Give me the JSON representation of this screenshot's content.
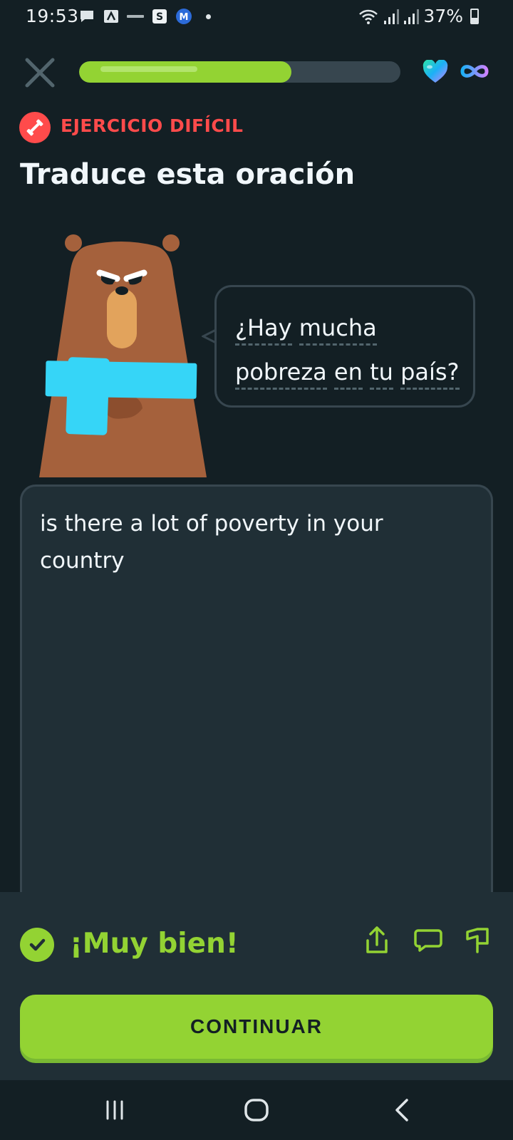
{
  "status_bar": {
    "time": "19:53",
    "battery": "37%",
    "notification_icons": [
      "message-icon",
      "app-a-icon",
      "app-small-icon",
      "s-app-icon",
      "m-app-icon",
      "dot-icon"
    ]
  },
  "header": {
    "progress": 0.66,
    "hearts": "infinite"
  },
  "exercise": {
    "badge": "EJERCICIO DIFÍCIL",
    "title": "Traduce esta oración"
  },
  "bubble": {
    "line1": [
      "¿Hay",
      "mucha"
    ],
    "line2": [
      "pobreza",
      "en",
      "tu",
      "país?"
    ]
  },
  "answer": {
    "text": "is there a lot of poverty in your country"
  },
  "feedback": {
    "title": "¡Muy bien!",
    "button_label": "CONTINUAR"
  },
  "colors": {
    "background": "#131f24",
    "panel": "#202f36",
    "border": "#37464f",
    "accent_green": "#93d333",
    "accent_red": "#ff4b4b",
    "bear_brown": "#a5613c",
    "scarf_blue": "#36d5f7"
  }
}
